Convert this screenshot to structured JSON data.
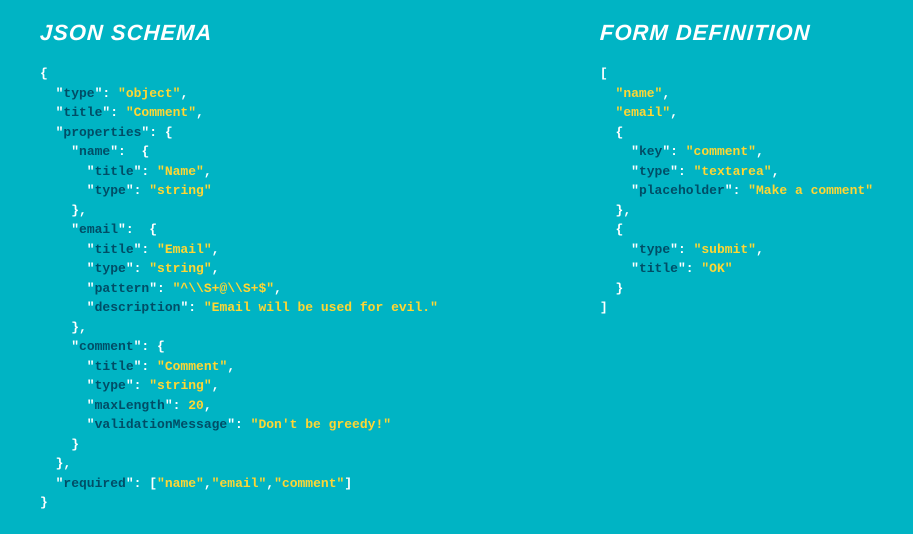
{
  "headings": {
    "left": "JSON SCHEMA",
    "right": "FORM DEFINITION"
  },
  "json_schema": {
    "type": "object",
    "title": "Comment",
    "properties": {
      "name": {
        "title": "Name",
        "type": "string"
      },
      "email": {
        "title": "Email",
        "type": "string",
        "pattern": "^\\\\S+@\\\\S+$",
        "description": "Email will be used for evil."
      },
      "comment": {
        "title": "Comment",
        "type": "string",
        "maxLength": 20,
        "validationMessage": "Don't be greedy!"
      }
    },
    "required": [
      "name",
      "email",
      "comment"
    ]
  },
  "form_definition": [
    "name",
    "email",
    {
      "key": "comment",
      "type": "textarea",
      "placeholder": "Make a comment"
    },
    {
      "type": "submit",
      "title": "OK"
    }
  ],
  "tokens": {
    "left": [
      [
        {
          "c": "p",
          "t": "{"
        }
      ],
      [
        {
          "c": "p",
          "t": "  \""
        },
        {
          "c": "k",
          "t": "type"
        },
        {
          "c": "p",
          "t": "\": "
        },
        {
          "c": "s",
          "t": "\"object\""
        },
        {
          "c": "p",
          "t": ","
        }
      ],
      [
        {
          "c": "p",
          "t": "  \""
        },
        {
          "c": "k",
          "t": "title"
        },
        {
          "c": "p",
          "t": "\": "
        },
        {
          "c": "s",
          "t": "\"Comment\""
        },
        {
          "c": "p",
          "t": ","
        }
      ],
      [
        {
          "c": "p",
          "t": "  \""
        },
        {
          "c": "k",
          "t": "properties"
        },
        {
          "c": "p",
          "t": "\": {"
        }
      ],
      [
        {
          "c": "p",
          "t": "    \""
        },
        {
          "c": "k",
          "t": "name"
        },
        {
          "c": "p",
          "t": "\":  {"
        }
      ],
      [
        {
          "c": "p",
          "t": "      \""
        },
        {
          "c": "k",
          "t": "title"
        },
        {
          "c": "p",
          "t": "\": "
        },
        {
          "c": "s",
          "t": "\"Name\""
        },
        {
          "c": "p",
          "t": ","
        }
      ],
      [
        {
          "c": "p",
          "t": "      \""
        },
        {
          "c": "k",
          "t": "type"
        },
        {
          "c": "p",
          "t": "\": "
        },
        {
          "c": "s",
          "t": "\"string\""
        }
      ],
      [
        {
          "c": "p",
          "t": "    },"
        }
      ],
      [
        {
          "c": "p",
          "t": "    \""
        },
        {
          "c": "k",
          "t": "email"
        },
        {
          "c": "p",
          "t": "\":  {"
        }
      ],
      [
        {
          "c": "p",
          "t": "      \""
        },
        {
          "c": "k",
          "t": "title"
        },
        {
          "c": "p",
          "t": "\": "
        },
        {
          "c": "s",
          "t": "\"Email\""
        },
        {
          "c": "p",
          "t": ","
        }
      ],
      [
        {
          "c": "p",
          "t": "      \""
        },
        {
          "c": "k",
          "t": "type"
        },
        {
          "c": "p",
          "t": "\": "
        },
        {
          "c": "s",
          "t": "\"string\""
        },
        {
          "c": "p",
          "t": ","
        }
      ],
      [
        {
          "c": "p",
          "t": "      \""
        },
        {
          "c": "k",
          "t": "pattern"
        },
        {
          "c": "p",
          "t": "\": "
        },
        {
          "c": "s",
          "t": "\"^\\\\S+@\\\\S+$\""
        },
        {
          "c": "p",
          "t": ","
        }
      ],
      [
        {
          "c": "p",
          "t": "      \""
        },
        {
          "c": "k",
          "t": "description"
        },
        {
          "c": "p",
          "t": "\": "
        },
        {
          "c": "s",
          "t": "\"Email will be used for evil.\""
        }
      ],
      [
        {
          "c": "p",
          "t": "    },"
        }
      ],
      [
        {
          "c": "p",
          "t": "    \""
        },
        {
          "c": "k",
          "t": "comment"
        },
        {
          "c": "p",
          "t": "\": {"
        }
      ],
      [
        {
          "c": "p",
          "t": "      \""
        },
        {
          "c": "k",
          "t": "title"
        },
        {
          "c": "p",
          "t": "\": "
        },
        {
          "c": "s",
          "t": "\"Comment\""
        },
        {
          "c": "p",
          "t": ","
        }
      ],
      [
        {
          "c": "p",
          "t": "      \""
        },
        {
          "c": "k",
          "t": "type"
        },
        {
          "c": "p",
          "t": "\": "
        },
        {
          "c": "s",
          "t": "\"string\""
        },
        {
          "c": "p",
          "t": ","
        }
      ],
      [
        {
          "c": "p",
          "t": "      \""
        },
        {
          "c": "k",
          "t": "maxLength"
        },
        {
          "c": "p",
          "t": "\": "
        },
        {
          "c": "n",
          "t": "20"
        },
        {
          "c": "p",
          "t": ","
        }
      ],
      [
        {
          "c": "p",
          "t": "      \""
        },
        {
          "c": "k",
          "t": "validationMessage"
        },
        {
          "c": "p",
          "t": "\": "
        },
        {
          "c": "s",
          "t": "\"Don't be greedy!\""
        }
      ],
      [
        {
          "c": "p",
          "t": "    }"
        }
      ],
      [
        {
          "c": "p",
          "t": "  },"
        }
      ],
      [
        {
          "c": "p",
          "t": "  \""
        },
        {
          "c": "k",
          "t": "required"
        },
        {
          "c": "p",
          "t": "\": ["
        },
        {
          "c": "s",
          "t": "\"name\""
        },
        {
          "c": "p",
          "t": ","
        },
        {
          "c": "s",
          "t": "\"email\""
        },
        {
          "c": "p",
          "t": ","
        },
        {
          "c": "s",
          "t": "\"comment\""
        },
        {
          "c": "p",
          "t": "]"
        }
      ],
      [
        {
          "c": "p",
          "t": "}"
        }
      ]
    ],
    "right": [
      [
        {
          "c": "p",
          "t": "["
        }
      ],
      [
        {
          "c": "p",
          "t": "  "
        },
        {
          "c": "s",
          "t": "\"name\""
        },
        {
          "c": "p",
          "t": ","
        }
      ],
      [
        {
          "c": "p",
          "t": "  "
        },
        {
          "c": "s",
          "t": "\"email\""
        },
        {
          "c": "p",
          "t": ","
        }
      ],
      [
        {
          "c": "p",
          "t": "  {"
        }
      ],
      [
        {
          "c": "p",
          "t": "    \""
        },
        {
          "c": "k",
          "t": "key"
        },
        {
          "c": "p",
          "t": "\": "
        },
        {
          "c": "s",
          "t": "\"comment\""
        },
        {
          "c": "p",
          "t": ","
        }
      ],
      [
        {
          "c": "p",
          "t": "    \""
        },
        {
          "c": "k",
          "t": "type"
        },
        {
          "c": "p",
          "t": "\": "
        },
        {
          "c": "s",
          "t": "\"textarea\""
        },
        {
          "c": "p",
          "t": ","
        }
      ],
      [
        {
          "c": "p",
          "t": "    \""
        },
        {
          "c": "k",
          "t": "placeholder"
        },
        {
          "c": "p",
          "t": "\": "
        },
        {
          "c": "s",
          "t": "\"Make a comment\""
        }
      ],
      [
        {
          "c": "p",
          "t": "  },"
        }
      ],
      [
        {
          "c": "p",
          "t": "  {"
        }
      ],
      [
        {
          "c": "p",
          "t": "    \""
        },
        {
          "c": "k",
          "t": "type"
        },
        {
          "c": "p",
          "t": "\": "
        },
        {
          "c": "s",
          "t": "\"submit\""
        },
        {
          "c": "p",
          "t": ","
        }
      ],
      [
        {
          "c": "p",
          "t": "    \""
        },
        {
          "c": "k",
          "t": "title"
        },
        {
          "c": "p",
          "t": "\": "
        },
        {
          "c": "s",
          "t": "\"OK\""
        }
      ],
      [
        {
          "c": "p",
          "t": "  }"
        }
      ],
      [
        {
          "c": "p",
          "t": "]"
        }
      ]
    ]
  }
}
